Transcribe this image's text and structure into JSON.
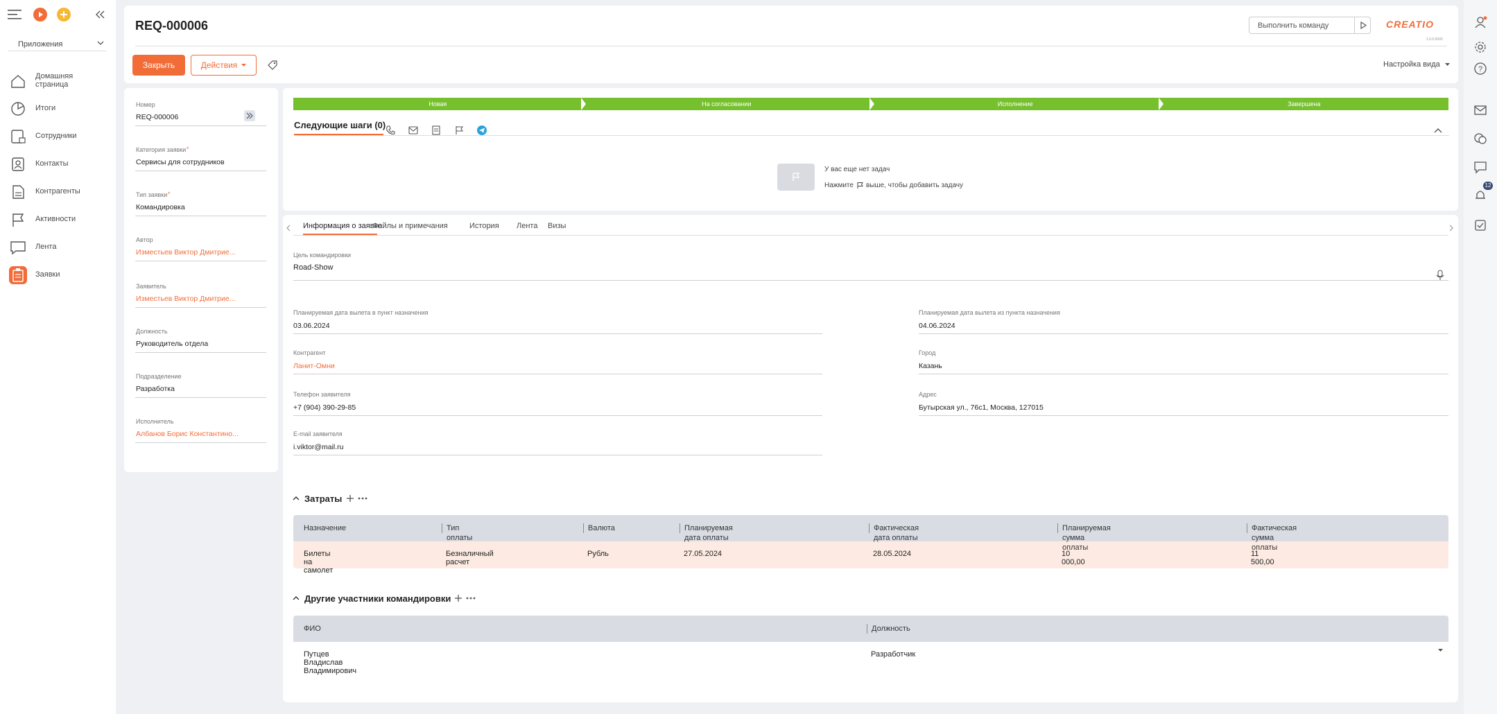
{
  "nav": {
    "apps_label": "Приложения",
    "items": [
      {
        "label": "Домашняя страница",
        "icon": "home-icon"
      },
      {
        "label": "Итоги",
        "icon": "pie-chart-icon"
      },
      {
        "label": "Сотрудники",
        "icon": "employees-icon"
      },
      {
        "label": "Контакты",
        "icon": "contacts-icon"
      },
      {
        "label": "Контрагенты",
        "icon": "accounts-icon"
      },
      {
        "label": "Активности",
        "icon": "flag-icon"
      },
      {
        "label": "Лента",
        "icon": "chat-icon"
      },
      {
        "label": "Заявки",
        "icon": "clipboard-icon"
      }
    ]
  },
  "header": {
    "title": "REQ-000006",
    "command_placeholder": "Выполнить команду",
    "brand": "CREATIO",
    "version": "1.0.0.0000"
  },
  "toolbar": {
    "close_label": "Закрыть",
    "actions_label": "Действия",
    "view_settings_label": "Настройка вида"
  },
  "profile": {
    "fields": [
      {
        "label": "Номер",
        "value": "REQ-000006",
        "link": false,
        "required": false
      },
      {
        "label": "Категория заявки",
        "value": "Сервисы для сотрудников",
        "link": false,
        "required": true
      },
      {
        "label": "Тип заявки",
        "value": "Командировка",
        "link": false,
        "required": true
      },
      {
        "label": "Автор",
        "value": "Изместьев Виктор Дмитрие...",
        "link": true,
        "required": false
      },
      {
        "label": "Заявитель",
        "value": "Изместьев Виктор Дмитрие...",
        "link": true,
        "required": false
      },
      {
        "label": "Должность",
        "value": "Руководитель отдела",
        "link": false,
        "required": false
      },
      {
        "label": "Подразделение",
        "value": "Разработка",
        "link": false,
        "required": false
      },
      {
        "label": "Исполнитель",
        "value": "Албанов Борис Константино...",
        "link": true,
        "required": false
      }
    ]
  },
  "stages": [
    "Новая",
    "На согласовании",
    "Исполнение",
    "Завершена"
  ],
  "next_steps": {
    "title": "Следующие шаги (0)",
    "empty_line1": "У вас еще нет задач",
    "empty_line2_prefix": "Нажмите",
    "empty_line2_suffix": "выше, чтобы добавить задачу"
  },
  "tabs": [
    "Информация о заявке",
    "Файлы и примечания",
    "История",
    "Лента",
    "Визы"
  ],
  "details": {
    "purpose_label": "Цель командировки",
    "purpose_value": "Road-Show",
    "left": [
      {
        "label": "Планируемая дата вылета в пункт назначения",
        "value": "03.06.2024",
        "link": false
      },
      {
        "label": "Контрагент",
        "value": "Ланит-Омни",
        "link": true
      },
      {
        "label": "Телефон заявителя",
        "value": "+7 (904) 390-29-85",
        "link": false
      },
      {
        "label": "E-mail заявителя",
        "value": "i.viktor@mail.ru",
        "link": false
      }
    ],
    "right": [
      {
        "label": "Планируемая дата вылета из пункта назначения",
        "value": "04.06.2024"
      },
      {
        "label": "Город",
        "value": "Казань"
      },
      {
        "label": "Адрес",
        "value": "Бутырская ул., 76с1, Москва, 127015"
      }
    ]
  },
  "expenses": {
    "title": "Затраты",
    "columns": [
      "Назначение",
      "Тип оплаты",
      "Валюта",
      "Планируемая дата оплаты",
      "Фактическая дата оплаты",
      "Планируемая сумма оплаты",
      "Фактическая сумма оплаты"
    ],
    "rows": [
      [
        "Билеты на самолет",
        "Безналичный расчет",
        "Рубль",
        "27.05.2024",
        "28.05.2024",
        "10 000,00",
        "11 500,00"
      ]
    ]
  },
  "participants": {
    "title": "Другие участники командировки",
    "columns": [
      "ФИО",
      "Должность"
    ],
    "rows": [
      [
        "Путцев Владислав Владимирович",
        "Разработчик"
      ]
    ]
  },
  "notifications_count": "12",
  "colors": {
    "accent": "#f26c38",
    "stage": "#76c02e",
    "row_highlight": "#fdebe3",
    "table_header": "#d9dde3"
  }
}
